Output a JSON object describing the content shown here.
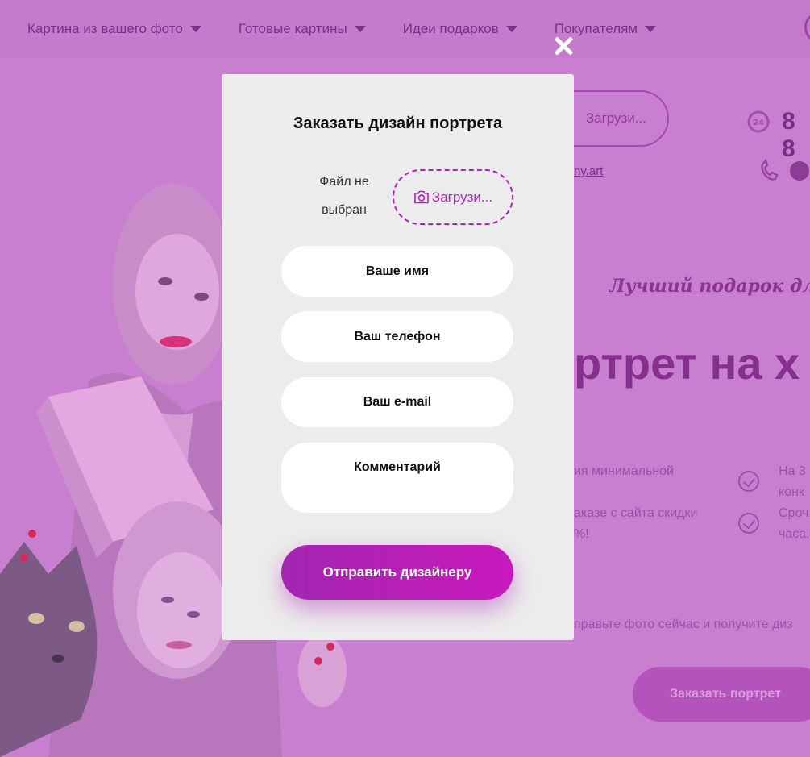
{
  "nav": {
    "items": [
      {
        "label": "Картина из вашего фото"
      },
      {
        "label": "Готовые картины"
      },
      {
        "label": "Идеи подарков"
      },
      {
        "label": "Покупателям"
      }
    ]
  },
  "background": {
    "upload_label": "Загрузи...",
    "phone": "8 8",
    "link": "ny.art",
    "tagline": "Лучший подарок для",
    "heading": "ртрет на х",
    "bullets": [
      {
        "line1": "ия минимальной",
        "line2": ""
      },
      {
        "line1": "аказе с сайта скидки",
        "line2": "%!"
      },
      {
        "line1": "На 3",
        "line2": "конк"
      },
      {
        "line1": "Сроч",
        "line2": "часа!"
      }
    ],
    "footer_text": "правьте фото сейчас и получите диз",
    "order_button": "Заказать портрет"
  },
  "modal": {
    "title": "Заказать дизайн портрета",
    "file_status_line1": "Файл не",
    "file_status_line2": "выбран",
    "upload_label": "Загрузи...",
    "fields": {
      "name": "Ваше имя",
      "phone": "Ваш телефон",
      "email": "Ваш e-mail",
      "comment": "Комментарий"
    },
    "submit_label": "Отправить дизайнеру"
  },
  "colors": {
    "overlay": "#c97fd0",
    "modal_bg": "#ececec",
    "accent": "#b21fbd",
    "submit_gradient_start": "#a326b1",
    "submit_gradient_end": "#c919bd"
  }
}
